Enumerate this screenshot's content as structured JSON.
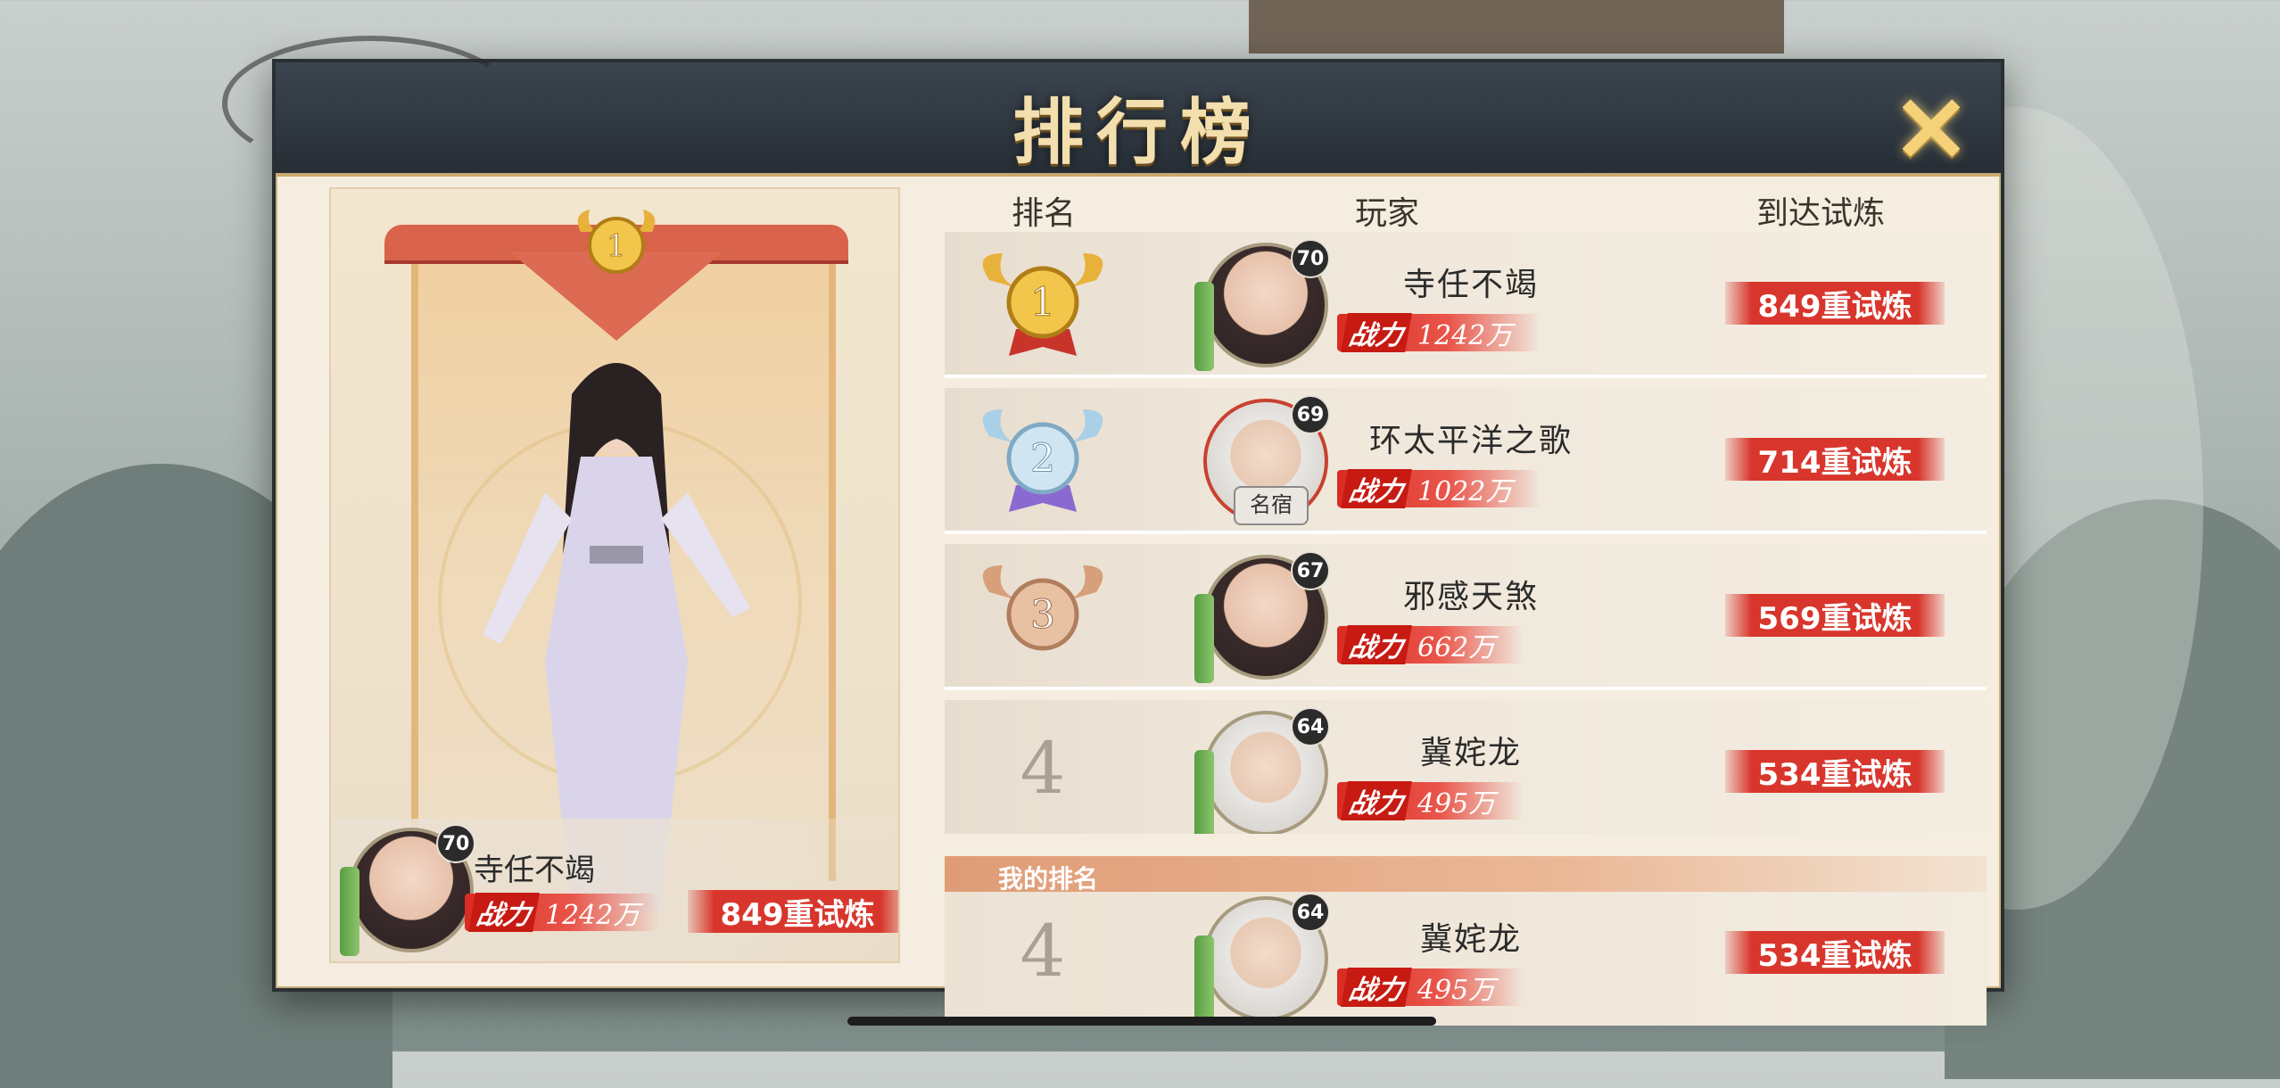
{
  "modal": {
    "title": "排行榜",
    "close_icon": "×"
  },
  "columns": {
    "rank": "排名",
    "player": "玩家",
    "trial": "到达试炼"
  },
  "featured": {
    "name": "寺任不竭",
    "level": "70",
    "power_label": "战力",
    "power": "1242万",
    "trial": "849重试炼",
    "medal_rank": "1"
  },
  "rows": [
    {
      "rank": "1",
      "name": "寺任不竭",
      "level": "70",
      "power_label": "战力",
      "power": "1242万",
      "trial": "849重试炼",
      "medal": "gold"
    },
    {
      "rank": "2",
      "name": "环太平洋之歌",
      "level": "69",
      "power_label": "战力",
      "power": "1022万",
      "trial": "714重试炼",
      "medal": "silver",
      "tag": "名宿"
    },
    {
      "rank": "3",
      "name": "邪感天煞",
      "level": "67",
      "power_label": "战力",
      "power": "662万",
      "trial": "569重试炼",
      "medal": "bronze"
    },
    {
      "rank": "4",
      "name": "冀姹龙",
      "level": "64",
      "power_label": "战力",
      "power": "495万",
      "trial": "534重试炼",
      "medal": "none"
    }
  ],
  "my_rank": {
    "label": "我的排名",
    "rank": "4",
    "name": "冀姹龙",
    "level": "64",
    "power_label": "战力",
    "power": "495万",
    "trial": "534重试炼"
  },
  "colors": {
    "gold": "#e8b23a",
    "silver": "#9cc3dc",
    "bronze": "#d7a07a",
    "accent_red": "#d8362c"
  }
}
